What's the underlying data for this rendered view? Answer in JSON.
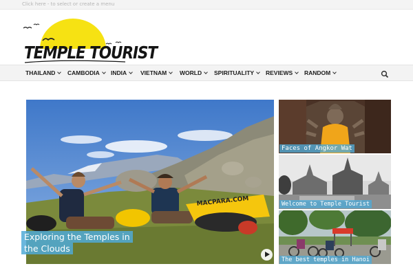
{
  "topbar": {
    "menu_link": "Click here - to select or create a menu"
  },
  "logo": {
    "text": "TEMPLE TOURIST",
    "sun_color": "#f6e213"
  },
  "nav": {
    "items": [
      {
        "label": "THAILAND"
      },
      {
        "label": "CAMBODIA"
      },
      {
        "label": "INDIA"
      },
      {
        "label": "VIETNAM"
      },
      {
        "label": "WORLD"
      },
      {
        "label": "SPIRITUALITY"
      },
      {
        "label": "REVIEWS"
      },
      {
        "label": "RANDOM"
      }
    ],
    "search_icon": "search-icon"
  },
  "featured": {
    "main": {
      "title": "Exploring the Temples in the Clouds",
      "banner_text": "MACPARA.COM",
      "play_icon": "play-icon"
    },
    "side": [
      {
        "title": "Faces of Angkor Wat"
      },
      {
        "title": "Welcome to Temple Tourist"
      },
      {
        "title": "The best temples in Hanoi"
      }
    ]
  },
  "colors": {
    "caption_bg": "#50aad7",
    "nav_bg": "#f3f3f3"
  }
}
